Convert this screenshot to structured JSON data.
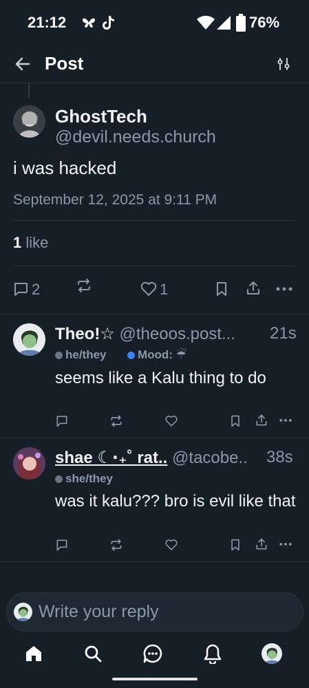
{
  "status_bar": {
    "time": "21:12",
    "battery": "76%",
    "icons": [
      "butterfly-icon",
      "tiktok-icon",
      "wifi-icon",
      "signal-icon",
      "battery-icon"
    ]
  },
  "header": {
    "title": "Post",
    "back_icon": "arrow-left-icon",
    "settings_icon": "sliders-icon"
  },
  "post": {
    "author_name": "GhostTech",
    "author_handle": "@devil.needs.church",
    "text": "i was hacked",
    "date": "September 12, 2025 at 9:11 PM",
    "likes_count": "1",
    "likes_label": " like",
    "actions": {
      "reply_count": "2",
      "like_count": "1"
    }
  },
  "replies": [
    {
      "name": "Theo!☆",
      "handle": "@theoos.post...",
      "time": "21s",
      "tags": [
        {
          "label": "he/they",
          "color": "#6b7685"
        },
        {
          "label": "Mood: ☔",
          "color": "#3b82f6"
        }
      ],
      "text": "seems like a Kalu thing to do"
    },
    {
      "name": "shae ☾⋅₊˚ rat..",
      "handle": "@tacobe..",
      "time": "38s",
      "tags": [
        {
          "label": "she/they",
          "color": "#6b7685"
        }
      ],
      "text": "was it kalu??? bro is evil like that"
    }
  ],
  "composer": {
    "placeholder": "Write your reply"
  },
  "nav": {
    "items": [
      "home-icon",
      "search-icon",
      "chat-icon",
      "bell-icon",
      "profile-avatar"
    ]
  },
  "colors": {
    "background": "#161e27",
    "muted": "#8b98a9",
    "divider": "#2a3441",
    "accent": "#3b82f6"
  }
}
